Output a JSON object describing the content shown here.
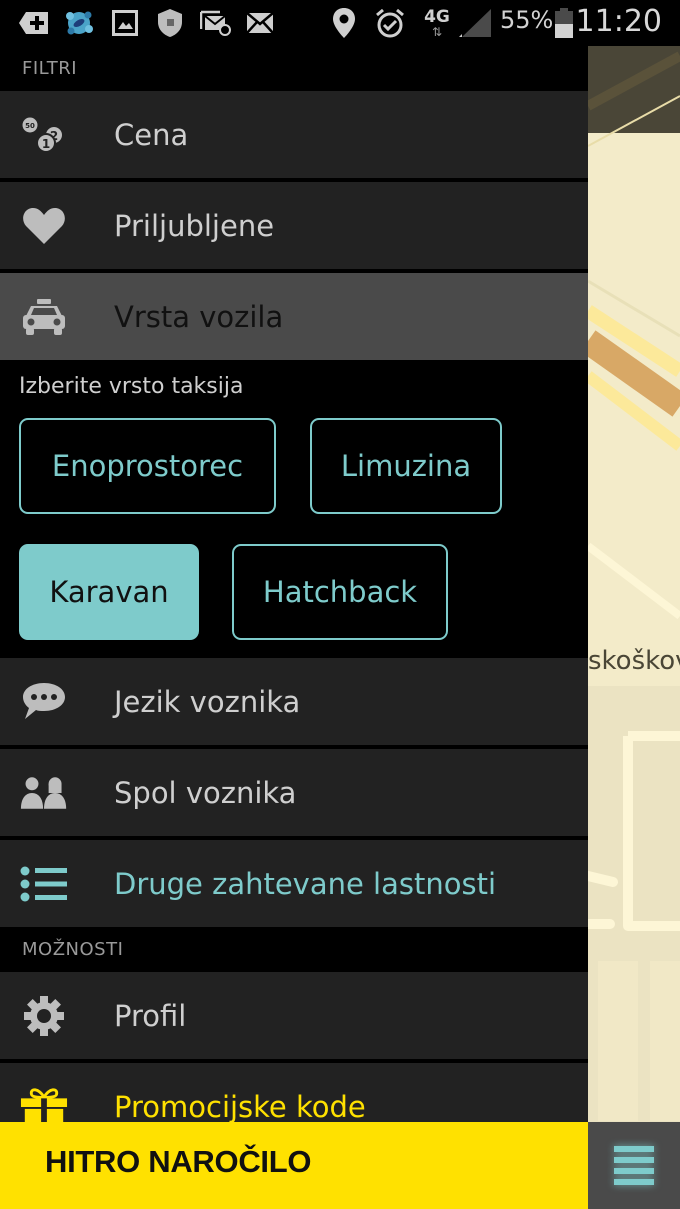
{
  "status_bar": {
    "left_icons": [
      "add-notification-icon",
      "app-bubbles-icon",
      "image-icon",
      "shield-icon",
      "email-at-icon",
      "mail-icon"
    ],
    "right_icons": [
      "location-icon",
      "alarm-icon",
      "network-4g-icon",
      "signal-icon",
      "battery-icon"
    ],
    "network": "4G",
    "battery": "55%",
    "time": "11:20"
  },
  "drawer": {
    "filters_header": "FILTRI",
    "filters": [
      {
        "label": "Cena",
        "icon": "coins-icon"
      },
      {
        "label": "Priljubljene",
        "icon": "heart-icon"
      },
      {
        "label": "Vrsta vozila",
        "icon": "taxi-icon",
        "active": true
      }
    ],
    "vehicle_type": {
      "title": "Izberite vrsto taksija",
      "options": [
        {
          "label": "Enoprostorec",
          "selected": false
        },
        {
          "label": "Limuzina",
          "selected": false
        },
        {
          "label": "Karavan",
          "selected": true
        },
        {
          "label": "Hatchback",
          "selected": false
        }
      ]
    },
    "filters_more": [
      {
        "label": "Jezik voznika",
        "icon": "speech-bubble-icon"
      },
      {
        "label": "Spol voznika",
        "icon": "people-icon"
      },
      {
        "label": "Druge zahtevane lastnosti",
        "icon": "list-icon"
      }
    ],
    "options_header": "MOŽNOSTI",
    "options": [
      {
        "label": "Profil",
        "icon": "gear-icon"
      },
      {
        "label": "Promocijske kode",
        "icon": "gift-icon"
      }
    ]
  },
  "map": {
    "street_label": "skoškov"
  },
  "bottom_bar": {
    "quick_order_label": "HITRO NAROČILO",
    "menu_icon": "hamburger-menu-icon"
  },
  "colors": {
    "accent": "#7ecbcb",
    "promo": "#ffe100",
    "item_bg": "#222222",
    "active_bg": "#4a4a4a"
  }
}
